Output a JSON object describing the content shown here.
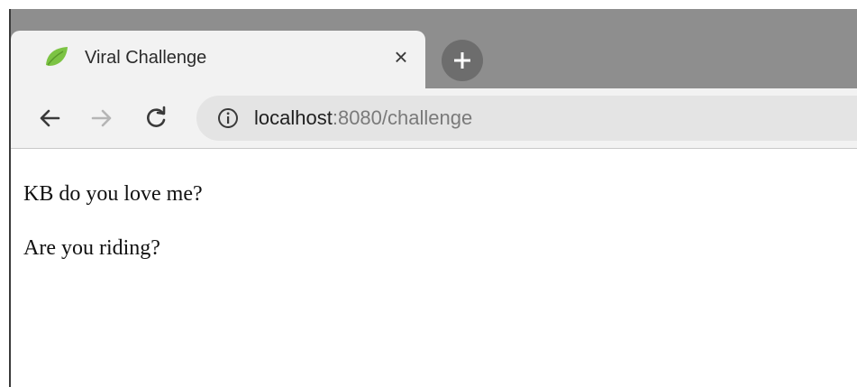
{
  "browser": {
    "tab": {
      "title": "Viral Challenge",
      "favicon": "spring-leaf-icon",
      "close_glyph": "×"
    },
    "new_tab_icon": "plus-icon",
    "toolbar": {
      "back_icon": "back-arrow-icon",
      "forward_icon": "forward-arrow-icon",
      "reload_icon": "reload-icon",
      "info_icon": "info-icon"
    },
    "address_bar": {
      "host": "localhost",
      "rest": ":8080/challenge"
    }
  },
  "page": {
    "lines": [
      "KB do you love me?",
      "Are you riding?"
    ]
  },
  "colors": {
    "tabstrip": "#8e8e8e",
    "toolbar": "#f2f2f2",
    "omnibox": "#e4e4e4",
    "favicon": "#7cc343",
    "new_tab": "#6d6d6d"
  }
}
